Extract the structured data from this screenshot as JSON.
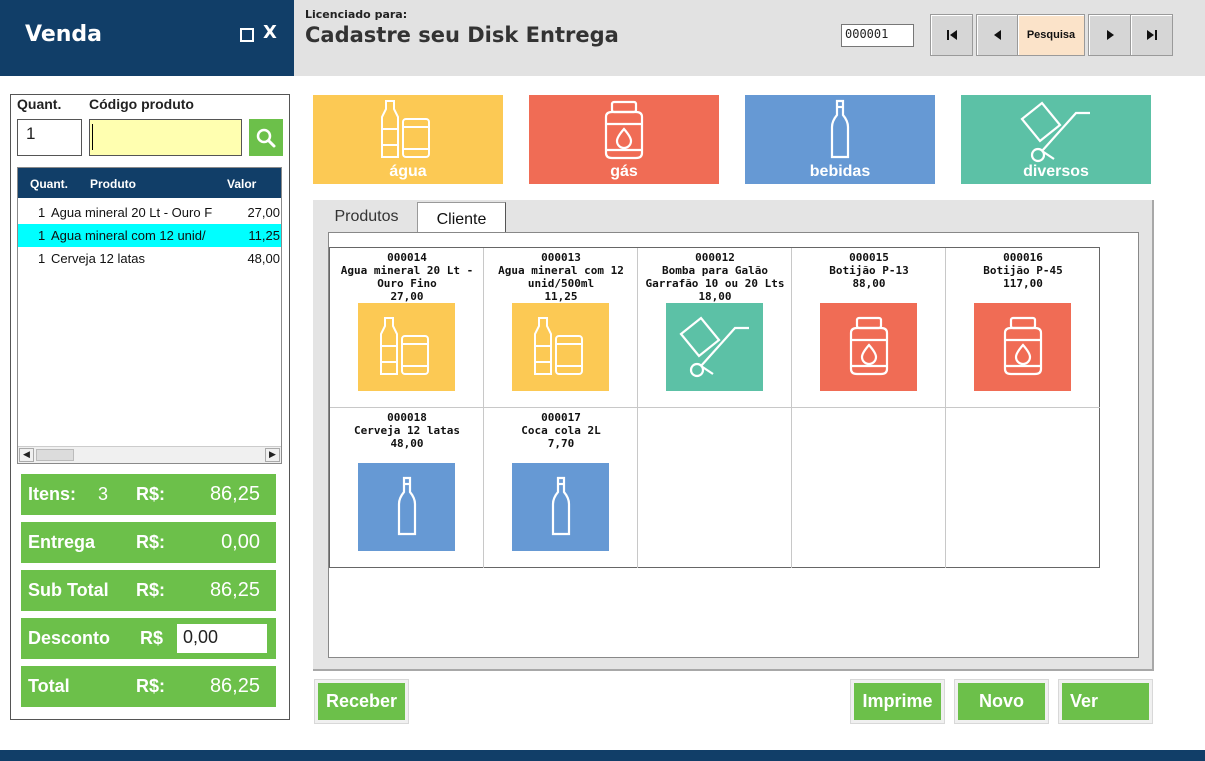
{
  "window": {
    "title": "Venda",
    "maximize_icon": "maximize-icon",
    "close_label": "X"
  },
  "header": {
    "licensed_label": "Licenciado para:",
    "licensed_name": "Cadastre seu Disk Entrega",
    "record_code": "000001",
    "search_label": "Pesquisa",
    "nav_icons": [
      "first-record-icon",
      "previous-record-icon",
      "next-record-icon",
      "last-record-icon"
    ]
  },
  "entry": {
    "quant_label": "Quant.",
    "code_label": "Código produto",
    "quantity": "1",
    "code_value": ""
  },
  "cart": {
    "columns": [
      "Quant.",
      "Produto",
      "Valor"
    ],
    "rows": [
      {
        "qty": "1",
        "product": "Agua mineral 20 Lt - Ouro F",
        "value": "27,00",
        "selected": false
      },
      {
        "qty": "1",
        "product": "Agua mineral com 12 unid/",
        "value": "11,25",
        "selected": true
      },
      {
        "qty": "1",
        "product": "Cerveja 12 latas",
        "value": "48,00",
        "selected": false
      }
    ]
  },
  "totals": {
    "items_label": "Itens:",
    "items_count": "3",
    "items_currency": "R$:",
    "items_value": "86,25",
    "delivery_label": "Entrega",
    "delivery_currency": "R$:",
    "delivery_value": "0,00",
    "subtotal_label": "Sub Total",
    "subtotal_currency": "R$:",
    "subtotal_value": "86,25",
    "discount_label": "Desconto",
    "discount_currency": "R$",
    "discount_value": "0,00",
    "total_label": "Total",
    "total_currency": "R$:",
    "total_value": "86,25"
  },
  "categories": [
    {
      "label": "água",
      "icon": "water-bottle-icon",
      "color": "#fcc954"
    },
    {
      "label": "gás",
      "icon": "gas-cylinder-icon",
      "color": "#f06c55"
    },
    {
      "label": "bebidas",
      "icon": "bottle-icon",
      "color": "#6699d4"
    },
    {
      "label": "diversos",
      "icon": "hand-truck-icon",
      "color": "#5cc1a6"
    }
  ],
  "tabs": {
    "products": "Produtos",
    "client": "Cliente"
  },
  "products": [
    {
      "code": "000014",
      "name": "Agua mineral 20 Lt - Ouro Fino",
      "price": "27,00",
      "icon": "water-bottle-icon",
      "color": "#fcc954"
    },
    {
      "code": "000013",
      "name": "Agua mineral com 12 unid/500ml",
      "price": "11,25",
      "icon": "water-bottle-icon",
      "color": "#fcc954"
    },
    {
      "code": "000012",
      "name": "Bomba para Galão Garrafão 10 ou 20 Lts",
      "price": "18,00",
      "icon": "hand-truck-icon",
      "color": "#5cc1a6"
    },
    {
      "code": "000015",
      "name": "Botijão P-13",
      "price": "88,00",
      "icon": "gas-cylinder-icon",
      "color": "#f06c55"
    },
    {
      "code": "000016",
      "name": "Botijão P-45",
      "price": "117,00",
      "icon": "gas-cylinder-icon",
      "color": "#f06c55"
    },
    {
      "code": "000018",
      "name": "Cerveja 12 latas",
      "price": "48,00",
      "icon": "bottle-icon",
      "color": "#6699d4"
    },
    {
      "code": "000017",
      "name": "Coca cola 2L",
      "price": "7,70",
      "icon": "bottle-icon",
      "color": "#6699d4"
    }
  ],
  "actions": {
    "receive": "Receber",
    "print": "Imprime",
    "new": "Novo",
    "view": "Ver"
  },
  "colors": {
    "navy": "#113e68",
    "green": "#6cc04a",
    "selected_row": "#00ffff",
    "code_input": "#ffffb0"
  }
}
